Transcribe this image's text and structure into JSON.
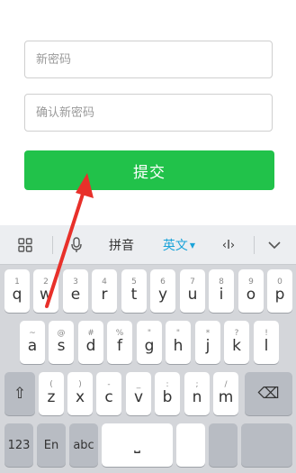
{
  "form": {
    "new_password_placeholder": "新密码",
    "confirm_password_placeholder": "确认新密码",
    "submit_label": "提交"
  },
  "keyboard": {
    "toolbar": {
      "grid_icon": "grid-icon",
      "mic_icon": "microphone-icon",
      "pinyin_label": "拼音",
      "english_label": "英文",
      "cursor_label": "‹I›",
      "collapse_icon": "chevron-down-icon"
    },
    "rows": [
      [
        {
          "main": "q",
          "sub": "1"
        },
        {
          "main": "w",
          "sub": "2"
        },
        {
          "main": "e",
          "sub": "3"
        },
        {
          "main": "r",
          "sub": "4"
        },
        {
          "main": "t",
          "sub": "5"
        },
        {
          "main": "y",
          "sub": "6"
        },
        {
          "main": "u",
          "sub": "7"
        },
        {
          "main": "i",
          "sub": "8"
        },
        {
          "main": "o",
          "sub": "9"
        },
        {
          "main": "p",
          "sub": "0"
        }
      ],
      [
        {
          "main": "a",
          "sub": "~"
        },
        {
          "main": "s",
          "sub": "@"
        },
        {
          "main": "d",
          "sub": "#"
        },
        {
          "main": "f",
          "sub": "%"
        },
        {
          "main": "g",
          "sub": "\""
        },
        {
          "main": "h",
          "sub": "\""
        },
        {
          "main": "j",
          "sub": "*"
        },
        {
          "main": "k",
          "sub": "?"
        },
        {
          "main": "l",
          "sub": "!"
        }
      ],
      [
        {
          "main": "z",
          "sub": "("
        },
        {
          "main": "x",
          "sub": ")"
        },
        {
          "main": "c",
          "sub": "-"
        },
        {
          "main": "v",
          "sub": "_"
        },
        {
          "main": "b",
          "sub": ":"
        },
        {
          "main": "n",
          "sub": ";"
        },
        {
          "main": "m",
          "sub": "/"
        }
      ]
    ],
    "shift_glyph": "⇧",
    "backspace_glyph": "⌫",
    "num_label": "123",
    "en_label": "En",
    "abc_label": "abc",
    "space_glyph": "⎵"
  }
}
